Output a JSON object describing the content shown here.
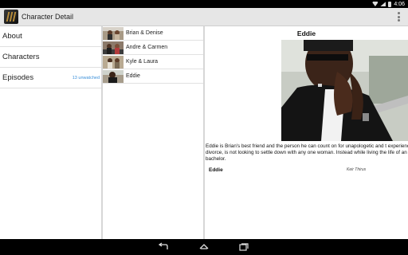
{
  "status": {
    "time": "4:06"
  },
  "actionbar": {
    "title": "Character Detail"
  },
  "sections": [
    {
      "label": "About",
      "badge": ""
    },
    {
      "label": "Characters",
      "badge": ""
    },
    {
      "label": "Episodes",
      "badge": "13 unwatched"
    }
  ],
  "characters": [
    {
      "name": "Brian & Denise"
    },
    {
      "name": "Andre & Carmen"
    },
    {
      "name": "Kyle & Laura"
    },
    {
      "name": "Eddie"
    }
  ],
  "detail": {
    "title": "Eddie",
    "description": "Eddie is Brian's best friend and the person he can count on for unapologetic and t experienced a divorce, is not looking to settle down with any one woman. Instead while living the life of an eligible bachelor.",
    "character": "Eddie",
    "actor": "Keir Thirus"
  },
  "colors": {
    "accent": "#3a8fd9",
    "actionbar": "#e6e6e6"
  },
  "icons": {
    "back": "back-icon",
    "home": "home-icon",
    "recents": "recents-icon",
    "overflow": "overflow-menu-icon"
  }
}
